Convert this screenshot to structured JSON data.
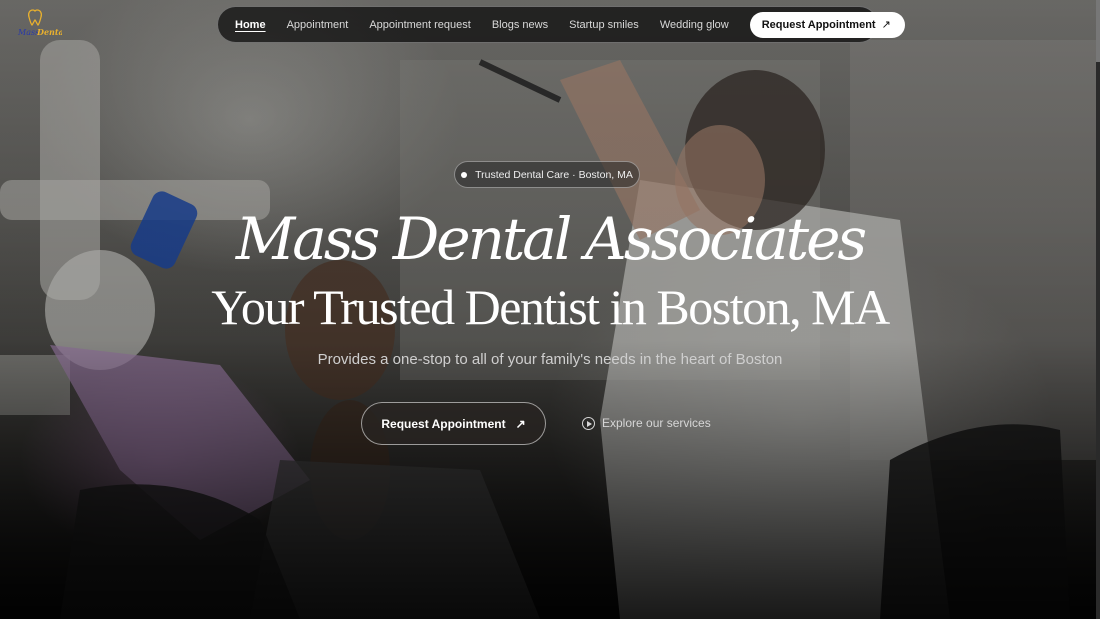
{
  "brand": {
    "logo_text": "Mass Dental",
    "logo_colors": {
      "primary": "#1c2a8c",
      "accent": "#e8b02e"
    }
  },
  "nav": {
    "links": [
      {
        "label": "Home",
        "active": true
      },
      {
        "label": "Appointment",
        "active": false
      },
      {
        "label": "Appointment request",
        "active": false
      },
      {
        "label": "Blogs news",
        "active": false
      },
      {
        "label": "Startup smiles",
        "active": false
      },
      {
        "label": "Wedding glow",
        "active": false
      }
    ],
    "cta_label": "Request Appointment",
    "cta_icon": "arrow-up-right-icon"
  },
  "hero": {
    "badge": "Trusted Dental Care · Boston, MA",
    "title": "Mass Dental Associates",
    "subtitle": "Your Trusted Dentist in Boston, MA",
    "tagline": "Provides a one-stop to all of your family's needs in the heart of Boston",
    "primary_cta": "Request Appointment",
    "primary_cta_icon": "arrow-up-right-icon",
    "secondary_cta": "Explore our services",
    "secondary_cta_icon": "play-circle-icon"
  },
  "colors": {
    "nav_bg": "#0a0a0a",
    "cta_bg": "#ffffff",
    "text": "#ffffff"
  }
}
